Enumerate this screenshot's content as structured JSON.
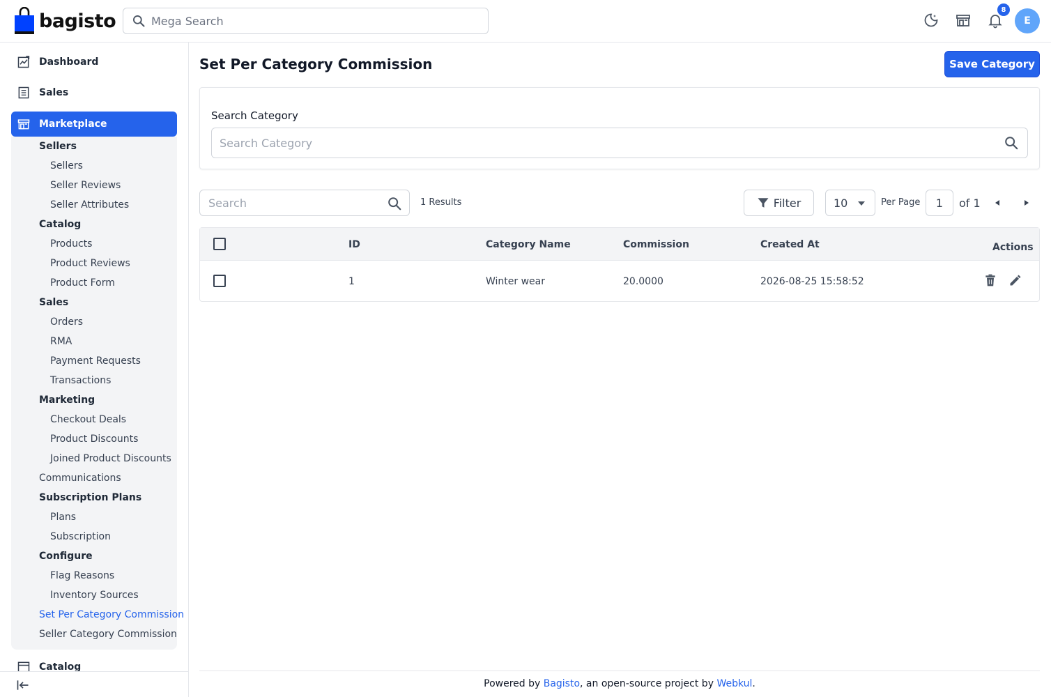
{
  "brand": {
    "name": "bagisto",
    "logo_color": "#0041ff"
  },
  "header": {
    "search_placeholder": "Mega Search",
    "notifications_count": "8",
    "avatar_initial": "E"
  },
  "sidebar": {
    "top_items": [
      {
        "label": "Dashboard",
        "icon": "dashboard-icon"
      },
      {
        "label": "Sales",
        "icon": "sales-icon"
      },
      {
        "label": "Marketplace",
        "icon": "store-icon",
        "active": true
      }
    ],
    "marketplace_items": [
      "Sellers",
      "Sellers",
      "Seller Reviews",
      "Seller Attributes",
      "Catalog",
      "Products",
      "Product Reviews",
      "Product Form",
      "Sales",
      "Orders",
      "RMA",
      "Payment Requests",
      "Transactions",
      "Marketing",
      "Checkout Deals",
      "Product Discounts",
      "Joined Product Discounts",
      "Communications",
      "Subscription Plans",
      "Plans",
      "Subscription",
      "Configure",
      "Flag Reasons",
      "Inventory Sources",
      "Set Per Category Commission",
      "Seller Category Commission"
    ],
    "bottom_item": "Catalog"
  },
  "page": {
    "title": "Set Per Category Commission",
    "save_label": "Save Category",
    "category_search_label": "Search Category",
    "category_search_placeholder": "Search Category"
  },
  "datagrid": {
    "search_placeholder": "Search",
    "results_text": "1 Results",
    "filter_label": "Filter",
    "per_page_value": "10",
    "per_page_label": "Per Page",
    "current_page": "1",
    "total_pages_text": "of 1",
    "columns": [
      "ID",
      "Category Name",
      "Commission",
      "Created At",
      "Actions"
    ],
    "rows": [
      {
        "id": "1",
        "category_name": "Winter wear",
        "commission": "20.0000",
        "created_at": "2026-08-25 15:58:52"
      }
    ]
  },
  "footer": {
    "prefix": "Powered by ",
    "link1": "Bagisto",
    "middle": ", an open-source project by ",
    "link2": "Webkul",
    "suffix": "."
  },
  "colors": {
    "primary": "#2563eb",
    "sidebar_panel": "#f3f4f6",
    "border": "#e5e7eb"
  }
}
